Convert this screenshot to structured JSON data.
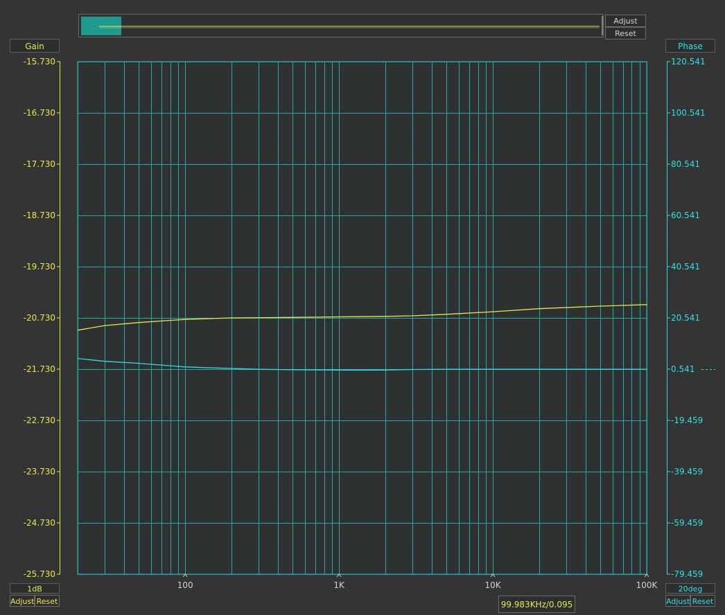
{
  "overview": {
    "adjust_label": "Adjust",
    "reset_label": "Reset"
  },
  "gain_axis": {
    "header": "Gain",
    "scale_label": "1dB",
    "adjust_label": "Adjust",
    "reset_label": "Reset",
    "color": "#e8e84a"
  },
  "phase_axis": {
    "header": "Phase",
    "scale_label": "20deg",
    "adjust_label": "Adjust",
    "reset_label": "Reset",
    "color": "#2fe0e4"
  },
  "cursor_readout": "99.983KHz/0.095",
  "colors": {
    "grid": "#2aa7a8",
    "plot_bg": "#2d3131",
    "page_bg": "#343434"
  },
  "chart_data": {
    "type": "line",
    "x_scale": "log",
    "xlim": [
      20,
      100000
    ],
    "x_ticks": [
      {
        "value": 100,
        "label": "100"
      },
      {
        "value": 1000,
        "label": "1K"
      },
      {
        "value": 10000,
        "label": "10K"
      },
      {
        "value": 100000,
        "label": "100K"
      }
    ],
    "y_left": {
      "label": "Gain",
      "ylim": [
        -25.73,
        -15.73
      ],
      "tick_labels": [
        "-15.730",
        "-16.730",
        "-17.730",
        "-18.730",
        "-19.730",
        "-20.730",
        "-21.730",
        "-22.730",
        "-23.730",
        "-24.730",
        "-25.730"
      ]
    },
    "y_right": {
      "label": "Phase",
      "ylim": [
        -79.459,
        120.541
      ],
      "tick_labels": [
        "120.541",
        "100.541",
        "80.541",
        "60.541",
        "40.541",
        "20.541",
        "0.541",
        "-19.459",
        "-39.459",
        "-59.459",
        "-79.459"
      ]
    },
    "grid": true,
    "series": [
      {
        "axis": "left",
        "color": "#e8e84a",
        "x": [
          20,
          30,
          50,
          100,
          200,
          500,
          1000,
          2000,
          3000,
          5000,
          10000,
          20000,
          50000,
          100000
        ],
        "y": [
          -20.97,
          -20.88,
          -20.82,
          -20.76,
          -20.73,
          -20.72,
          -20.71,
          -20.7,
          -20.69,
          -20.66,
          -20.61,
          -20.55,
          -20.5,
          -20.47
        ]
      },
      {
        "axis": "right",
        "color": "#2fe0e4",
        "x": [
          20,
          30,
          50,
          100,
          200,
          300,
          500,
          1000,
          2000,
          3000,
          5000,
          10000,
          100000
        ],
        "y": [
          4.7,
          3.6,
          2.8,
          1.4,
          0.8,
          0.5,
          0.3,
          0.2,
          0.2,
          0.4,
          0.5,
          0.5,
          0.5
        ]
      }
    ]
  }
}
